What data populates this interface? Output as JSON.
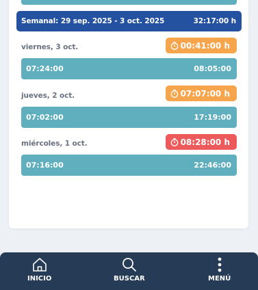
{
  "weekly": {
    "range_label": "Semanal: 29 sep. 2025 - 3 oct. 2025",
    "total": "32:17:00 h"
  },
  "days": [
    {
      "label": "viernes, 3 oct.",
      "badge": "00:41:00 h",
      "badge_color": "#f6a54c",
      "entries": [
        {
          "start": "07:24:00",
          "end": "08:05:00"
        }
      ]
    },
    {
      "label": "jueves, 2 oct.",
      "badge": "07:07:00 h",
      "badge_color": "#f6a54c",
      "entries": [
        {
          "start": "07:02:00",
          "end": "17:19:00"
        }
      ]
    },
    {
      "label": "miércoles, 1 oct.",
      "badge": "08:28:00 h",
      "badge_color": "#ec5a5c",
      "entries": [
        {
          "start": "07:16:00",
          "end": "22:46:00"
        }
      ]
    }
  ],
  "nav": {
    "home_label": "INICIO",
    "search_label": "BUSCAR",
    "menu_label": "MENÚ"
  },
  "colors": {
    "weekly_bar": "#2552a0",
    "entry_bar": "#5fafbf",
    "nav_bg": "#263b56",
    "background": "#edf0f5"
  }
}
